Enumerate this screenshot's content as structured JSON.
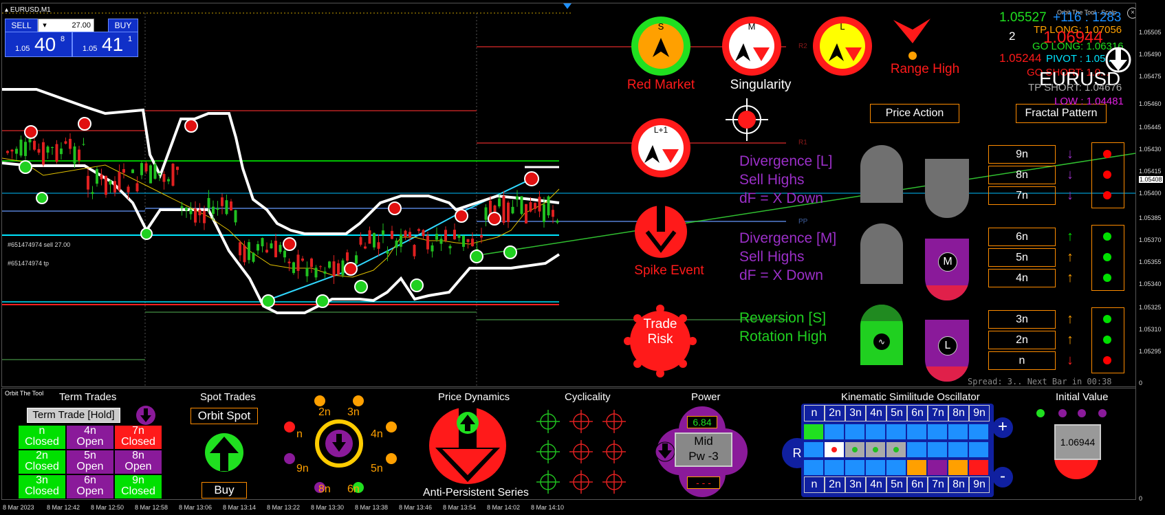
{
  "symbol_title": "EURUSD,M1",
  "trade_panel": {
    "sell_label": "SELL",
    "buy_label": "BUY",
    "lot": "27.00",
    "sell_prefix": "1.05",
    "sell_big": "40",
    "sell_sup": "8",
    "buy_prefix": "1.05",
    "buy_big": "41",
    "buy_sup": "1"
  },
  "chart_labels": {
    "order_sell": "#651474974 sell 27.00",
    "order_tp": "#651474974 tp",
    "r2": "R2",
    "r1": "R1",
    "pp": "PP"
  },
  "signals": {
    "red_market": "Red Market",
    "singularity": "Singularity",
    "range_high": "Range High",
    "spike_event": "Spike Event",
    "trade_risk_1": "Trade",
    "trade_risk_2": "Risk",
    "s_letter": "S",
    "m_letter": "M",
    "l_letter": "L",
    "l1_letter": "L+1"
  },
  "info_panel": {
    "price1": "1.05527",
    "ticks": "+116 : 1283",
    "count": "2",
    "tp_long": "TP LONG: 1.07056",
    "big_red": "1.06944",
    "go_long": "GO LONG: 1.06316",
    "price2": "1.05244",
    "pivot": "PIVOT : 1.05...",
    "go_short": "GO SHORT: 1.0...",
    "symbol": "EURUSD",
    "tp_short": "TP SHORT: 1.04676",
    "low": "LOW : 1.04481",
    "brand": "Orbit The Tool - Scalp"
  },
  "sections": {
    "price_action": "Price Action",
    "fractal_pattern": "Fractal Pattern"
  },
  "divergence": {
    "l_title": "Divergence [L]",
    "l_sub1": "Sell Highs",
    "l_sub2": "dF = X Down",
    "m_title": "Divergence [M]",
    "m_sub1": "Sell Highs",
    "m_sub2": "dF = X Down",
    "s_title": "Reversion [S]",
    "s_sub1": "Rotation High"
  },
  "fractal_rows": [
    {
      "label": "9n",
      "arrow": "down",
      "arrow_color": "#9b2fc8",
      "dot": "#ff0000"
    },
    {
      "label": "8n",
      "arrow": "down",
      "arrow_color": "#9b2fc8",
      "dot": "#ff0000"
    },
    {
      "label": "7n",
      "arrow": "down",
      "arrow_color": "#9b2fc8",
      "dot": "#ff0000"
    },
    {
      "label": "6n",
      "arrow": "up",
      "arrow_color": "#00e000",
      "dot": "#00e000"
    },
    {
      "label": "5n",
      "arrow": "up",
      "arrow_color": "#ffa000",
      "dot": "#00e000"
    },
    {
      "label": "4n",
      "arrow": "up",
      "arrow_color": "#ffa000",
      "dot": "#00e000"
    },
    {
      "label": "3n",
      "arrow": "up",
      "arrow_color": "#ffa000",
      "dot": "#00e000"
    },
    {
      "label": "2n",
      "arrow": "up",
      "arrow_color": "#ffa000",
      "dot": "#00e000"
    },
    {
      "label": "n",
      "arrow": "down",
      "arrow_color": "#ff2020",
      "dot": "#ff0000"
    }
  ],
  "spread_text": "Spread: 3.. Next Bar in 00:38",
  "price_axis": [
    "1.05505",
    "1.05490",
    "1.05475",
    "1.05460",
    "1.05445",
    "1.05430",
    "1.05415",
    "1.05408",
    "1.05400",
    "1.05385",
    "1.05370",
    "1.05355",
    "1.05340",
    "1.05325",
    "1.05310",
    "1.05295",
    "0",
    "0"
  ],
  "time_axis": [
    "8 Mar 2023",
    "8 Mar 12:42",
    "8 Mar 12:50",
    "8 Mar 12:58",
    "8 Mar 13:06",
    "8 Mar 13:14",
    "8 Mar 13:22",
    "8 Mar 13:30",
    "8 Mar 13:38",
    "8 Mar 13:46",
    "8 Mar 13:54",
    "8 Mar 14:02",
    "8 Mar 14:10"
  ],
  "sub": {
    "brand": "Orbit The Tool",
    "term_trades": "Term Trades",
    "term_hold": "Term Trade [Hold]",
    "spot_trades": "Spot Trades",
    "orbit_spot": "Orbit Spot",
    "buy": "Buy",
    "price_dynamics": "Price Dynamics",
    "anti_persistent": "Anti-Persistent Series",
    "cyclicality": "Cyclicality",
    "power": "Power",
    "power_value": "6.84",
    "power_mid": "Mid",
    "power_pw": "Pw -3",
    "power_dash": "- - -",
    "kso": "Kinematic Similitude Oscillator",
    "initial_value": "Initial Value",
    "initial_price": "1.06944",
    "r_label": "R",
    "plus": "+",
    "minus": "-"
  },
  "term_grid": [
    {
      "top": "n",
      "bot": "Closed",
      "bg": "#00e000"
    },
    {
      "top": "4n",
      "bot": "Open",
      "bg": "#8a1a9a"
    },
    {
      "top": "7n",
      "bot": "Closed",
      "bg": "#ff1a1a"
    },
    {
      "top": "2n",
      "bot": "Closed",
      "bg": "#00e000"
    },
    {
      "top": "5n",
      "bot": "Open",
      "bg": "#8a1a9a"
    },
    {
      "top": "8n",
      "bot": "Open",
      "bg": "#8a1a9a"
    },
    {
      "top": "3n",
      "bot": "Closed",
      "bg": "#00e000"
    },
    {
      "top": "6n",
      "bot": "Open",
      "bg": "#8a1a9a"
    },
    {
      "top": "9n",
      "bot": "Closed",
      "bg": "#00e000"
    }
  ],
  "orbit_labels": [
    "2n",
    "3n",
    "4n",
    "5n",
    "6n",
    "8n",
    "9n",
    "n"
  ],
  "kso_headers": [
    "n",
    "2n",
    "3n",
    "4n",
    "5n",
    "6n",
    "7n",
    "8n",
    "9n"
  ]
}
